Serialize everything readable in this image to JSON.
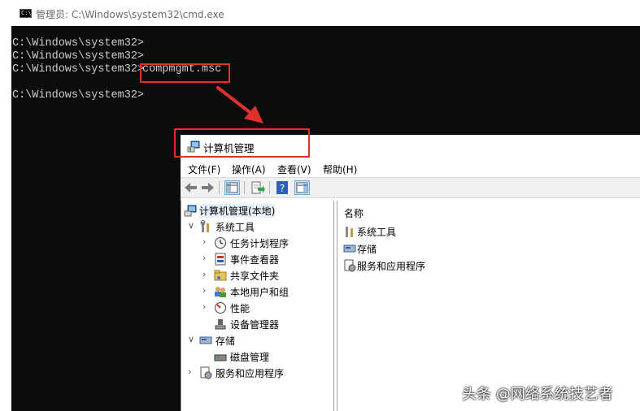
{
  "cmd": {
    "title": "管理员: C:\\Windows\\system32\\cmd.exe",
    "icon_text": "C:\\",
    "lines": [
      "C:\\Windows\\system32>",
      "C:\\Windows\\system32>",
      "C:\\Windows\\system32>",
      "compmgmt.msc",
      "C:\\Windows\\system32>"
    ]
  },
  "mmc": {
    "title": "计算机管理",
    "menu": [
      "文件(F)",
      "操作(A)",
      "查看(V)",
      "帮助(H)"
    ],
    "tree": {
      "root": "计算机管理(本地)",
      "system_tools": "系统工具",
      "task_scheduler": "任务计划程序",
      "event_viewer": "事件查看器",
      "shared_folders": "共享文件夹",
      "local_users": "本地用户和组",
      "performance": "性能",
      "device_manager": "设备管理器",
      "storage": "存储",
      "disk_management": "磁盘管理",
      "services_apps": "服务和应用程序"
    },
    "list": {
      "header": "名称",
      "items": [
        "系统工具",
        "存储",
        "服务和应用程序"
      ]
    }
  },
  "watermark": "头条 @网络系统技艺者",
  "colors": {
    "highlight": "#e0302c",
    "console_bg": "#0c0c0c",
    "console_text": "#cccccc"
  }
}
